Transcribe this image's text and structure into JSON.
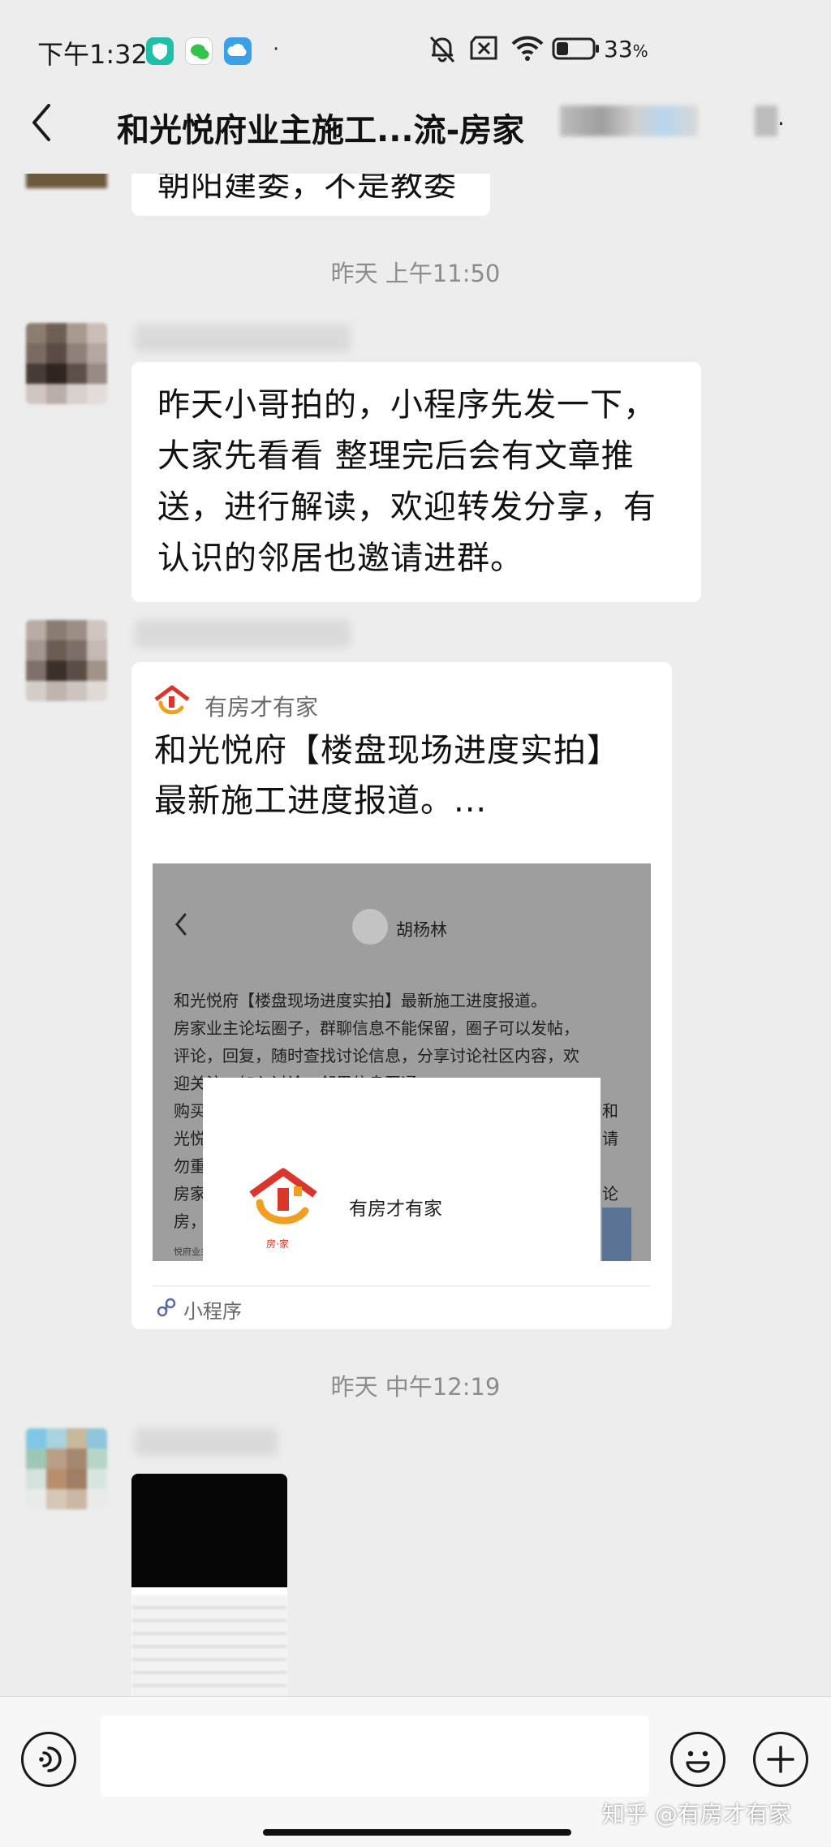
{
  "status_bar": {
    "time": "下午1:32",
    "dot": "·",
    "battery": "33",
    "battery_unit": "%",
    "icons": [
      "shield-app-icon",
      "wechat-app-icon",
      "cloud-app-icon",
      "mute-bell-icon",
      "no-sim-icon",
      "wifi-icon",
      "battery-icon"
    ]
  },
  "header": {
    "title": "和光悦府业主施工...流-房家",
    "back_icon": "chevron-left-icon",
    "more_icon": "more-dots-icon",
    "more_label": "·"
  },
  "messages": {
    "partial_text": "朝阳建委，不是教委",
    "timestamp_1": "昨天 上午11:50",
    "text_message": {
      "lines": [
        "昨天小哥拍的，小程序先发一下，",
        "大家先看看 整理完后会有文章推",
        "送，进行解读，欢迎转发分享，有",
        "认识的邻居也邀请进群。"
      ]
    },
    "mini_program": {
      "source": "有房才有家",
      "title_lines": [
        "和光悦府【楼盘现场进度实拍】",
        "最新施工进度报道。..."
      ],
      "preview": {
        "author": "胡杨林",
        "text_lines": [
          "和光悦府【楼盘现场进度实拍】最新施工进度报道。",
          "房家业主论坛圈子，群聊信息不能保留，圈子可以发帖，",
          "评论，回复，随时查找讨论信息，分享讨论社区内容，欢",
          "迎关注，加入讨论，邻里信息互通。",
          "购买"
        ],
        "right_fragments": [
          "和",
          "请",
          "论"
        ],
        "left_fragments": [
          "光悦",
          "勿重",
          "房家",
          "房，"
        ],
        "tiny_label": "悦府业主",
        "popup_name": "有房才有家",
        "logo_caption": "房·家"
      },
      "footer_label": "小程序"
    },
    "timestamp_2": "昨天 中午12:19"
  },
  "input_bar": {
    "voice_icon": "voice-icon",
    "emoji_icon": "emoji-icon",
    "plus_icon": "plus-icon",
    "input_value": ""
  },
  "watermark": "知乎 @有房才有家",
  "colors": {
    "background": "#ededed",
    "bubble": "#ffffff",
    "logo_red": "#d9372c",
    "logo_orange": "#f0a020",
    "link_blue": "#5a6aa8"
  }
}
